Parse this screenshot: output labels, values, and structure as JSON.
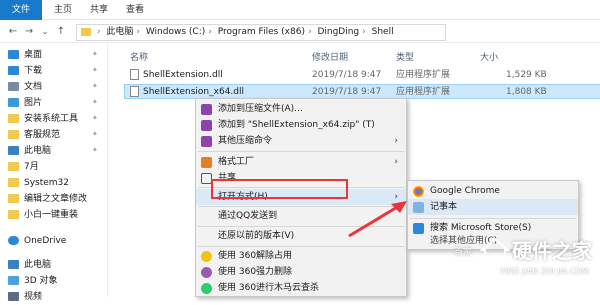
{
  "ribbon": {
    "tabs": [
      "文件",
      "主页",
      "共享",
      "查看"
    ]
  },
  "address": {
    "crumbs": [
      "此电脑",
      "Windows (C:)",
      "Program Files (x86)",
      "DingDing",
      "Shell"
    ]
  },
  "nav": {
    "items": [
      {
        "label": "桌面",
        "icon": "desktop-icon",
        "color": "#2b87d8",
        "pinned": true
      },
      {
        "label": "下载",
        "icon": "download-icon",
        "color": "#2b87d8",
        "pinned": true
      },
      {
        "label": "文档",
        "icon": "documents-icon",
        "color": "#7a8aa5",
        "pinned": true
      },
      {
        "label": "图片",
        "icon": "pictures-icon",
        "color": "#3a9ad9",
        "pinned": true
      },
      {
        "label": "安装系统工具",
        "icon": "folder-icon",
        "color": "#f2c94c",
        "pinned": true
      },
      {
        "label": "客服规范",
        "icon": "folder-icon",
        "color": "#f2c94c",
        "pinned": true
      },
      {
        "label": "此电脑",
        "icon": "computer-icon",
        "color": "#3b7fc4",
        "pinned": true
      },
      {
        "label": "7月",
        "icon": "folder-icon",
        "color": "#f2c94c",
        "pinned": false
      },
      {
        "label": "System32",
        "icon": "folder-icon",
        "color": "#f2c94c",
        "pinned": false
      },
      {
        "label": "编辑之文章修改",
        "icon": "folder-icon",
        "color": "#f2c94c",
        "pinned": false
      },
      {
        "label": "小白一键重装",
        "icon": "folder-icon",
        "color": "#f2c94c",
        "pinned": false
      },
      {
        "label": "OneDrive",
        "icon": "cloud-icon",
        "color": "#2b87d8",
        "pinned": false
      },
      {
        "label": "此电脑",
        "icon": "computer-icon",
        "color": "#3b7fc4",
        "pinned": false
      },
      {
        "label": "3D 对象",
        "icon": "3d-objects-icon",
        "color": "#4aa3df",
        "pinned": false
      },
      {
        "label": "视频",
        "icon": "videos-icon",
        "color": "#5b6b84",
        "pinned": false
      }
    ]
  },
  "list": {
    "headers": {
      "name": "名称",
      "date": "修改日期",
      "type": "类型",
      "size": "大小"
    },
    "rows": [
      {
        "name": "ShellExtension.dll",
        "date": "2019/7/18 9:47",
        "type": "应用程序扩展",
        "size": "1,529 KB",
        "selected": false
      },
      {
        "name": "ShellExtension_x64.dll",
        "date": "2019/7/18 9:47",
        "type": "应用程序扩展",
        "size": "1,808 KB",
        "selected": true
      }
    ]
  },
  "context_menu": {
    "items": [
      {
        "label": "添加到压缩文件(A)...",
        "icon": "winrar-icon"
      },
      {
        "label": "添加到 \"ShellExtension_x64.zip\" (T)",
        "icon": "winrar-icon"
      },
      {
        "label": "其他压缩命令",
        "icon": "winrar-icon"
      },
      {
        "label": "格式工厂",
        "icon": "format-factory-icon"
      },
      {
        "label": "共享",
        "icon": "share-icon"
      },
      {
        "label": "打开方式(H)",
        "icon": ""
      },
      {
        "label": "通过QQ发送到",
        "icon": ""
      },
      {
        "label": "还原以前的版本(V)",
        "icon": ""
      },
      {
        "label": "使用 360解除占用",
        "icon": "360-icon"
      },
      {
        "label": "使用 360强力删除",
        "icon": "360-icon"
      },
      {
        "label": "使用 360进行木马云查杀",
        "icon": "360-shield-icon"
      }
    ]
  },
  "submenu": {
    "items": [
      {
        "label": "Google Chrome",
        "icon": "chrome-icon"
      },
      {
        "label": "记事本",
        "icon": "notepad-icon"
      },
      {
        "label": "搜索 Microsoft Store(S)",
        "icon": "store-icon"
      },
      {
        "label": "选择其他应用(C)",
        "icon": ""
      }
    ]
  },
  "watermark": {
    "brand": "硬件之家",
    "pinyin": "YING JIAN ZHI JIA.COM",
    "small": "百家"
  },
  "colors": {
    "accent": "#1979ca",
    "highlight": "#e8363a",
    "selection": "#cce8ff"
  }
}
